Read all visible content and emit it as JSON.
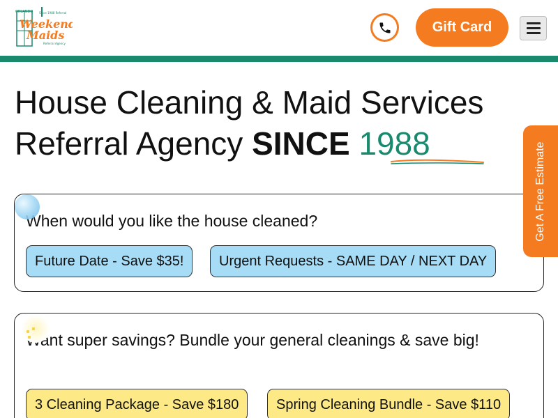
{
  "header": {
    "logo": {
      "line1": "Weekend",
      "line2": "Maids",
      "small_top": "ORLANDO",
      "small_tag": "Since 1988 Referral",
      "small_bottom": "Referral Agency"
    },
    "phone_icon": "phone-icon",
    "gift_card_label": "Gift Card",
    "menu_icon": "hamburger-menu-icon"
  },
  "headline": {
    "line1": "House Cleaning & Maid Services",
    "line2_prefix": "Referral Agency ",
    "line2_bold": "SINCE",
    "line2_year": "1988"
  },
  "side_tab": {
    "label": "Get A Free Estimate"
  },
  "cards": [
    {
      "question": "When would you like the house cleaned?",
      "options": [
        "Future Date - Save $35!",
        "Urgent Requests - SAME DAY / NEXT DAY"
      ]
    },
    {
      "question": "Want super savings? Bundle your general cleanings & save big!",
      "options": [
        "3 Cleaning Package - Save $180",
        "Spring Cleaning Bundle - Save $110"
      ]
    }
  ],
  "colors": {
    "brand_orange": "#f47b20",
    "brand_green": "#1a8a6e",
    "option_blue": "#a6dcf5",
    "option_yellow": "#fde985"
  }
}
